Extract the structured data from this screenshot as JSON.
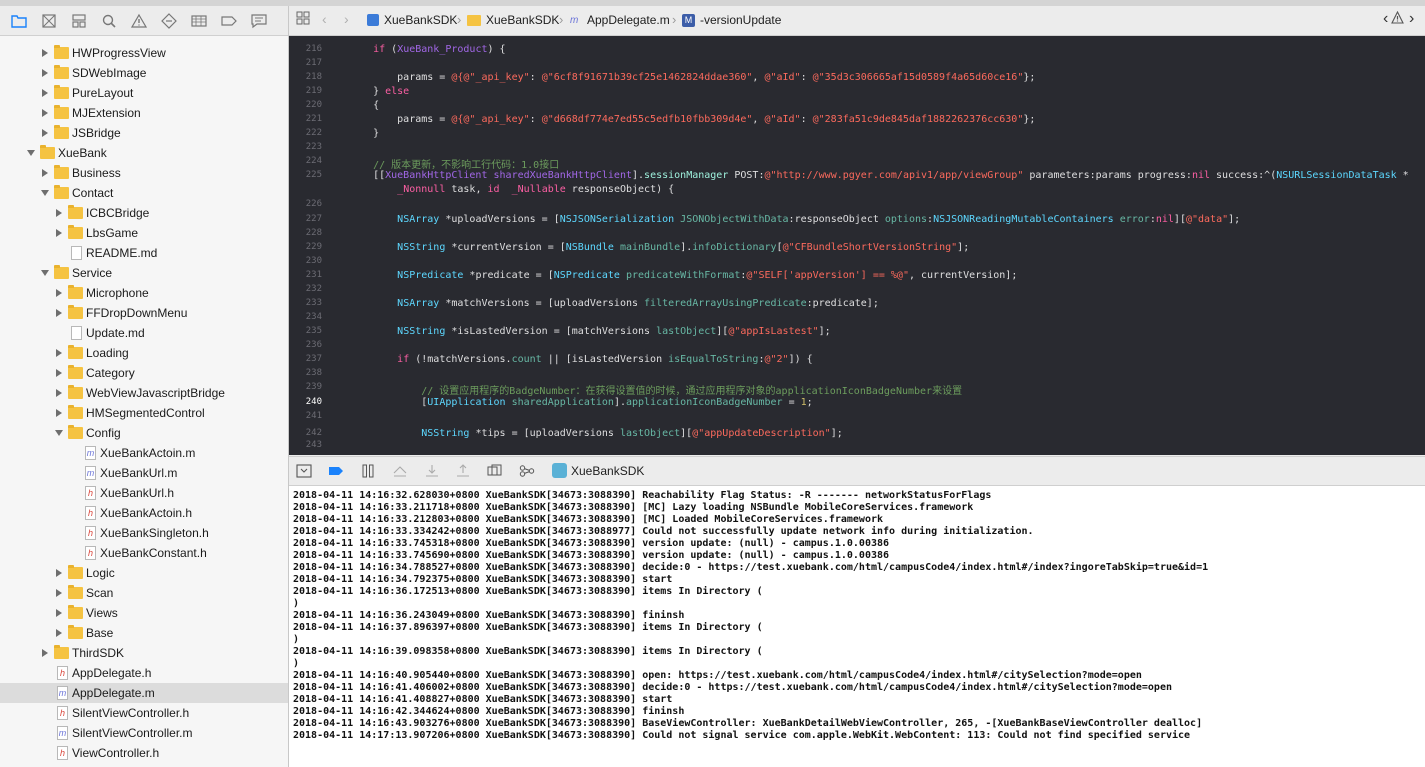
{
  "colors": {
    "folder": "#f5c342",
    "editor_bg": "#292a30",
    "selection": "#dcdcdc",
    "accent": "#1a82fb"
  },
  "navigator": {
    "toolbar_icons": [
      "project-navigator-icon",
      "source-control-icon",
      "symbol-navigator-icon",
      "find-navigator-icon",
      "issue-navigator-icon",
      "test-navigator-icon",
      "debug-navigator-icon",
      "breakpoint-navigator-icon",
      "report-navigator-icon"
    ],
    "items": [
      {
        "label": "HWProgressView",
        "kind": "folder",
        "depth": 1,
        "disclosure": "closed"
      },
      {
        "label": "SDWebImage",
        "kind": "folder",
        "depth": 1,
        "disclosure": "closed"
      },
      {
        "label": "PureLayout",
        "kind": "folder",
        "depth": 1,
        "disclosure": "closed"
      },
      {
        "label": "MJExtension",
        "kind": "folder",
        "depth": 1,
        "disclosure": "closed"
      },
      {
        "label": "JSBridge",
        "kind": "folder",
        "depth": 1,
        "disclosure": "closed"
      },
      {
        "label": "XueBank",
        "kind": "folder",
        "depth": 0,
        "disclosure": "open"
      },
      {
        "label": "Business",
        "kind": "folder",
        "depth": 1,
        "disclosure": "closed"
      },
      {
        "label": "Contact",
        "kind": "folder",
        "depth": 1,
        "disclosure": "open"
      },
      {
        "label": "ICBCBridge",
        "kind": "folder",
        "depth": 2,
        "disclosure": "closed"
      },
      {
        "label": "LbsGame",
        "kind": "folder",
        "depth": 2,
        "disclosure": "closed"
      },
      {
        "label": "README.md",
        "kind": "md",
        "depth": 2,
        "disclosure": "none"
      },
      {
        "label": "Service",
        "kind": "folder",
        "depth": 1,
        "disclosure": "open"
      },
      {
        "label": "Microphone",
        "kind": "folder",
        "depth": 2,
        "disclosure": "closed"
      },
      {
        "label": "FFDropDownMenu",
        "kind": "folder",
        "depth": 2,
        "disclosure": "closed"
      },
      {
        "label": "Update.md",
        "kind": "md",
        "depth": 2,
        "disclosure": "none"
      },
      {
        "label": "Loading",
        "kind": "folder",
        "depth": 2,
        "disclosure": "closed"
      },
      {
        "label": "Category",
        "kind": "folder",
        "depth": 2,
        "disclosure": "closed"
      },
      {
        "label": "WebViewJavascriptBridge",
        "kind": "folder",
        "depth": 2,
        "disclosure": "closed"
      },
      {
        "label": "HMSegmentedControl",
        "kind": "folder",
        "depth": 2,
        "disclosure": "closed"
      },
      {
        "label": "Config",
        "kind": "folder",
        "depth": 2,
        "disclosure": "open"
      },
      {
        "label": "XueBankActoin.m",
        "kind": "m",
        "depth": 3,
        "disclosure": "none"
      },
      {
        "label": "XueBankUrl.m",
        "kind": "m",
        "depth": 3,
        "disclosure": "none"
      },
      {
        "label": "XueBankUrl.h",
        "kind": "h",
        "depth": 3,
        "disclosure": "none"
      },
      {
        "label": "XueBankActoin.h",
        "kind": "h",
        "depth": 3,
        "disclosure": "none"
      },
      {
        "label": "XueBankSingleton.h",
        "kind": "h",
        "depth": 3,
        "disclosure": "none"
      },
      {
        "label": "XueBankConstant.h",
        "kind": "h",
        "depth": 3,
        "disclosure": "none"
      },
      {
        "label": "Logic",
        "kind": "folder",
        "depth": 2,
        "disclosure": "closed"
      },
      {
        "label": "Scan",
        "kind": "folder",
        "depth": 2,
        "disclosure": "closed"
      },
      {
        "label": "Views",
        "kind": "folder",
        "depth": 2,
        "disclosure": "closed"
      },
      {
        "label": "Base",
        "kind": "folder",
        "depth": 2,
        "disclosure": "closed"
      },
      {
        "label": "ThirdSDK",
        "kind": "folder",
        "depth": 1,
        "disclosure": "closed"
      },
      {
        "label": "AppDelegate.h",
        "kind": "h",
        "depth": 1,
        "disclosure": "none"
      },
      {
        "label": "AppDelegate.m",
        "kind": "m",
        "depth": 1,
        "disclosure": "none",
        "selected": true
      },
      {
        "label": "SilentViewController.h",
        "kind": "h",
        "depth": 1,
        "disclosure": "none"
      },
      {
        "label": "SilentViewController.m",
        "kind": "m",
        "depth": 1,
        "disclosure": "none"
      },
      {
        "label": "ViewController.h",
        "kind": "h",
        "depth": 1,
        "disclosure": "none"
      }
    ]
  },
  "jumpbar": {
    "crumbs": [
      {
        "label": "XueBankSDK",
        "icon": "project-icon"
      },
      {
        "label": "XueBankSDK",
        "icon": "folder-icon"
      },
      {
        "label": "AppDelegate.m",
        "icon": "m-file-icon"
      },
      {
        "label": "-versionUpdate",
        "icon": "method-icon"
      }
    ]
  },
  "editor": {
    "current_line": "240",
    "lines": [
      {
        "n": "216",
        "segs": [
          [
            "    ",
            ""
          ],
          [
            "if",
            "kw"
          ],
          [
            " (",
            ""
          ],
          [
            "XueBank_Product",
            "usr"
          ],
          [
            ") {",
            ""
          ]
        ]
      },
      {
        "n": "217",
        "segs": []
      },
      {
        "n": "218",
        "segs": [
          [
            "        params = ",
            ""
          ],
          [
            "@{@\"_api_key\"",
            "str"
          ],
          [
            ": ",
            ""
          ],
          [
            "@\"6cf8f91671b39cf25e1462824ddae360\"",
            "str"
          ],
          [
            ", ",
            ""
          ],
          [
            "@\"aId\"",
            "str"
          ],
          [
            ": ",
            ""
          ],
          [
            "@\"35d3c306665af15d0589f4a65d60ce16\"",
            "str"
          ],
          [
            "};",
            ""
          ]
        ]
      },
      {
        "n": "219",
        "segs": [
          [
            "    } ",
            ""
          ],
          [
            "else",
            "kw"
          ]
        ]
      },
      {
        "n": "220",
        "segs": [
          [
            "    {",
            ""
          ]
        ]
      },
      {
        "n": "221",
        "segs": [
          [
            "        params = ",
            ""
          ],
          [
            "@{@\"_api_key\"",
            "str"
          ],
          [
            ": ",
            ""
          ],
          [
            "@\"d668df774e7ed55c5edfb10fbb309d4e\"",
            "str"
          ],
          [
            ", ",
            ""
          ],
          [
            "@\"aId\"",
            "str"
          ],
          [
            ": ",
            ""
          ],
          [
            "@\"283fa51c9de845daf1882262376cc630\"",
            "str"
          ],
          [
            "};",
            ""
          ]
        ]
      },
      {
        "n": "222",
        "segs": [
          [
            "    }",
            ""
          ]
        ]
      },
      {
        "n": "223",
        "segs": []
      },
      {
        "n": "224",
        "segs": [
          [
            "    // 版本更新，不影响工行代码：1.0接口",
            "cm"
          ]
        ]
      },
      {
        "n": "225",
        "segs": [
          [
            "    [[",
            ""
          ],
          [
            "XueBankHttpClient",
            "usr"
          ],
          [
            " ",
            ""
          ],
          [
            "sharedXueBankHttpClient",
            "usr"
          ],
          [
            "].",
            ""
          ],
          [
            "sessionManager",
            "prop"
          ],
          [
            " POST:",
            ""
          ],
          [
            "@\"http://www.pgyer.com/apiv1/app/viewGroup\"",
            "str"
          ],
          [
            " parameters:params progress:",
            ""
          ],
          [
            "nil",
            "kw"
          ],
          [
            " success:^(",
            ""
          ],
          [
            "NSURLSessionDataTask",
            "cls"
          ],
          [
            " *",
            ""
          ]
        ]
      },
      {
        "n": "",
        "segs": [
          [
            "        ",
            ""
          ],
          [
            "_Nonnull",
            "kw"
          ],
          [
            " task, ",
            ""
          ],
          [
            "id",
            "kw"
          ],
          [
            "  ",
            ""
          ],
          [
            "_Nullable",
            "kw"
          ],
          [
            " responseObject) {",
            ""
          ]
        ]
      },
      {
        "n": "226",
        "segs": []
      },
      {
        "n": "227",
        "segs": [
          [
            "        ",
            ""
          ],
          [
            "NSArray",
            "cls"
          ],
          [
            " *uploadVersions = [",
            ""
          ],
          [
            "NSJSONSerialization",
            "cls"
          ],
          [
            " ",
            ""
          ],
          [
            "JSONObjectWithData",
            "mth"
          ],
          [
            ":responseObject ",
            ""
          ],
          [
            "options",
            "mth"
          ],
          [
            ":",
            ""
          ],
          [
            "NSJSONReadingMutableContainers",
            "cls"
          ],
          [
            " ",
            ""
          ],
          [
            "error",
            "mth"
          ],
          [
            ":",
            ""
          ],
          [
            "nil",
            "kw"
          ],
          [
            "][",
            ""
          ],
          [
            "@\"data\"",
            "str"
          ],
          [
            "];",
            ""
          ]
        ]
      },
      {
        "n": "228",
        "segs": []
      },
      {
        "n": "229",
        "segs": [
          [
            "        ",
            ""
          ],
          [
            "NSString",
            "cls"
          ],
          [
            " *currentVersion = [",
            ""
          ],
          [
            "NSBundle",
            "cls"
          ],
          [
            " ",
            ""
          ],
          [
            "mainBundle",
            "mth"
          ],
          [
            "].",
            ""
          ],
          [
            "infoDictionary",
            "mth"
          ],
          [
            "[",
            ""
          ],
          [
            "@\"CFBundleShortVersionString\"",
            "str"
          ],
          [
            "];",
            ""
          ]
        ]
      },
      {
        "n": "230",
        "segs": []
      },
      {
        "n": "231",
        "segs": [
          [
            "        ",
            ""
          ],
          [
            "NSPredicate",
            "cls"
          ],
          [
            " *predicate = [",
            ""
          ],
          [
            "NSPredicate",
            "cls"
          ],
          [
            " ",
            ""
          ],
          [
            "predicateWithFormat",
            "mth"
          ],
          [
            ":",
            ""
          ],
          [
            "@\"SELF['appVersion'] == %@\"",
            "str"
          ],
          [
            ", currentVersion];",
            ""
          ]
        ]
      },
      {
        "n": "232",
        "segs": []
      },
      {
        "n": "233",
        "segs": [
          [
            "        ",
            ""
          ],
          [
            "NSArray",
            "cls"
          ],
          [
            " *matchVersions = [uploadVersions ",
            ""
          ],
          [
            "filteredArrayUsingPredicate",
            "mth"
          ],
          [
            ":predicate];",
            ""
          ]
        ]
      },
      {
        "n": "234",
        "segs": []
      },
      {
        "n": "235",
        "segs": [
          [
            "        ",
            ""
          ],
          [
            "NSString",
            "cls"
          ],
          [
            " *isLastedVersion = [matchVersions ",
            ""
          ],
          [
            "lastObject",
            "mth"
          ],
          [
            "][",
            ""
          ],
          [
            "@\"appIsLastest\"",
            "str"
          ],
          [
            "];",
            ""
          ]
        ]
      },
      {
        "n": "236",
        "segs": []
      },
      {
        "n": "237",
        "segs": [
          [
            "        ",
            ""
          ],
          [
            "if",
            "kw"
          ],
          [
            " (!matchVersions.",
            ""
          ],
          [
            "count",
            "mth"
          ],
          [
            " || [isLastedVersion ",
            ""
          ],
          [
            "isEqualToString",
            "mth"
          ],
          [
            ":",
            ""
          ],
          [
            "@\"2\"",
            "str"
          ],
          [
            "]) {",
            ""
          ]
        ]
      },
      {
        "n": "238",
        "segs": []
      },
      {
        "n": "239",
        "segs": [
          [
            "            // 设置应用程序的BadgeNumber：在获得设置值的时候，通过应用程序对象的applicationIconBadgeNumber来设置",
            "cm"
          ]
        ]
      },
      {
        "n": "240",
        "segs": [
          [
            "            [",
            ""
          ],
          [
            "UIApplication",
            "cls"
          ],
          [
            " ",
            ""
          ],
          [
            "sharedApplication",
            "mth"
          ],
          [
            "].",
            ""
          ],
          [
            "applicationIconBadgeNumber",
            "mth"
          ],
          [
            " = ",
            ""
          ],
          [
            "1",
            "num"
          ],
          [
            ";",
            ""
          ]
        ]
      },
      {
        "n": "241",
        "segs": []
      },
      {
        "n": "242",
        "segs": [
          [
            "            ",
            ""
          ],
          [
            "NSString",
            "cls"
          ],
          [
            " *tips = [uploadVersions ",
            ""
          ],
          [
            "lastObject",
            "mth"
          ],
          [
            "][",
            ""
          ],
          [
            "@\"appUpdateDescription\"",
            "str"
          ],
          [
            "];",
            ""
          ]
        ]
      },
      {
        "n": "243",
        "segs": []
      }
    ]
  },
  "debugbar": {
    "target_label": "XueBankSDK",
    "icons": [
      "hide-debug-area-icon",
      "breakpoints-toggle-icon",
      "pause-icon",
      "step-over-icon",
      "step-into-icon",
      "step-out-icon",
      "view-hierarchy-icon",
      "memory-graph-icon"
    ]
  },
  "console": {
    "lines": [
      "2018-04-11 14:16:32.628030+0800 XueBankSDK[34673:3088390] Reachability Flag Status: -R ------- networkStatusForFlags",
      "2018-04-11 14:16:33.211718+0800 XueBankSDK[34673:3088390] [MC] Lazy loading NSBundle MobileCoreServices.framework",
      "2018-04-11 14:16:33.212803+0800 XueBankSDK[34673:3088390] [MC] Loaded MobileCoreServices.framework",
      "2018-04-11 14:16:33.334242+0800 XueBankSDK[34673:3088977] Could not successfully update network info during initialization.",
      "2018-04-11 14:16:33.745318+0800 XueBankSDK[34673:3088390] version update: (null) - campus.1.0.00386",
      "2018-04-11 14:16:33.745690+0800 XueBankSDK[34673:3088390] version update: (null) - campus.1.0.00386",
      "2018-04-11 14:16:34.788527+0800 XueBankSDK[34673:3088390] decide:0 - https://test.xuebank.com/html/campusCode4/index.html#/index?ingoreTabSkip=true&id=1",
      "2018-04-11 14:16:34.792375+0800 XueBankSDK[34673:3088390] start",
      "2018-04-11 14:16:36.172513+0800 XueBankSDK[34673:3088390] items In Directory (",
      ")",
      "2018-04-11 14:16:36.243049+0800 XueBankSDK[34673:3088390] fininsh",
      "2018-04-11 14:16:37.896397+0800 XueBankSDK[34673:3088390] items In Directory (",
      ")",
      "2018-04-11 14:16:39.098358+0800 XueBankSDK[34673:3088390] items In Directory (",
      ")",
      "2018-04-11 14:16:40.905440+0800 XueBankSDK[34673:3088390] open: https://test.xuebank.com/html/campusCode4/index.html#/citySelection?mode=open",
      "2018-04-11 14:16:41.406002+0800 XueBankSDK[34673:3088390] decide:0 - https://test.xuebank.com/html/campusCode4/index.html#/citySelection?mode=open",
      "2018-04-11 14:16:41.408827+0800 XueBankSDK[34673:3088390] start",
      "2018-04-11 14:16:42.344624+0800 XueBankSDK[34673:3088390] fininsh",
      "2018-04-11 14:16:43.903276+0800 XueBankSDK[34673:3088390] BaseViewController: XueBankDetailWebViewController, 265, -[XueBankBaseViewController dealloc]",
      "2018-04-11 14:17:13.907206+0800 XueBankSDK[34673:3088390] Could not signal service com.apple.WebKit.WebContent: 113: Could not find specified service"
    ]
  }
}
